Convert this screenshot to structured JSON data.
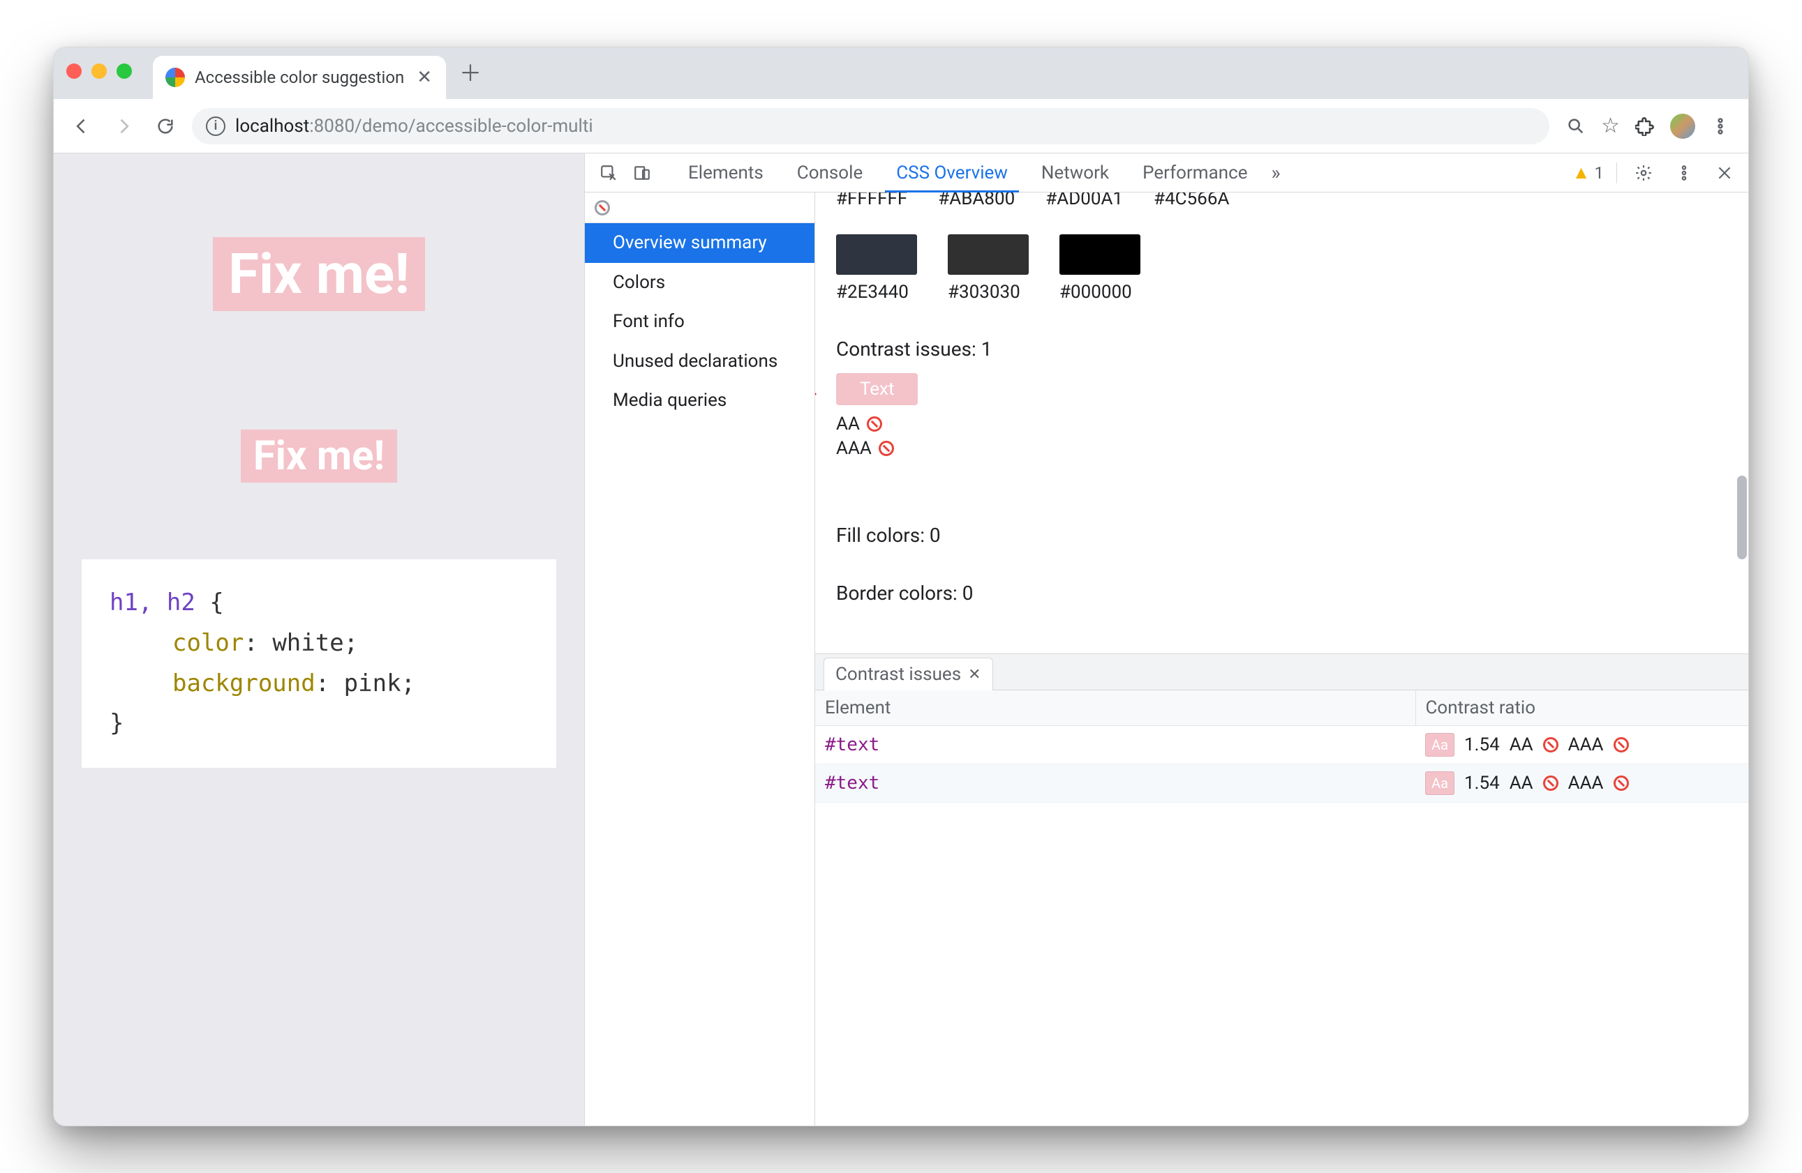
{
  "browser": {
    "tab_title": "Accessible color suggestion",
    "url_host": "localhost",
    "url_port_path": ":8080/demo/accessible-color-multi"
  },
  "page": {
    "h1_text": "Fix me!",
    "h2_text": "Fix me!",
    "css": {
      "selector": "h1, h2",
      "open_brace": " {",
      "prop_color": "color",
      "val_color": "white",
      "prop_bg": "background",
      "val_bg": "pink",
      "close_brace": "}",
      "colon_sep": ": ",
      "semicolon": ";"
    }
  },
  "devtools": {
    "tabs": {
      "elements": "Elements",
      "console": "Console",
      "css_overview": "CSS Overview",
      "network": "Network",
      "performance": "Performance",
      "more": "»"
    },
    "warnings_count": "1",
    "sidebar": {
      "overview_summary": "Overview summary",
      "colors": "Colors",
      "font_info": "Font info",
      "unused_declarations": "Unused declarations",
      "media_queries": "Media queries"
    },
    "colors_top": {
      "c1_hex": "#FFFFFF",
      "c2_hex": "#ABA800",
      "c3_hex": "#AD00A1",
      "c4_hex": "#4C566A"
    },
    "colors_mid": {
      "c1": {
        "hex": "#2E3440",
        "value": "#2E3440"
      },
      "c2": {
        "hex": "#303030",
        "value": "#303030"
      },
      "c3": {
        "hex": "#000000",
        "value": "#000000"
      }
    },
    "contrast": {
      "label": "Contrast issues: 1",
      "sample_text": "Text",
      "aa_label": "AA",
      "aaa_label": "AAA"
    },
    "fill_label": "Fill colors: 0",
    "border_label": "Border colors: 0",
    "drawer": {
      "tab_label": "Contrast issues",
      "col_element": "Element",
      "col_ratio": "Contrast ratio",
      "rows": [
        {
          "element": "#text",
          "swatch_text": "Aa",
          "ratio": "1.54",
          "aa": "AA",
          "aaa": "AAA"
        },
        {
          "element": "#text",
          "swatch_text": "Aa",
          "ratio": "1.54",
          "aa": "AA",
          "aaa": "AAA"
        }
      ]
    }
  }
}
